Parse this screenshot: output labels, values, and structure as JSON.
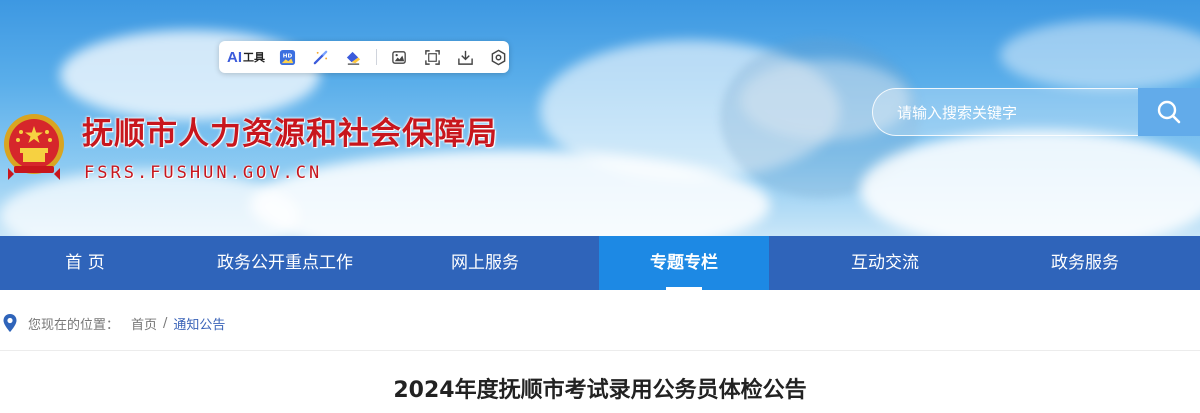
{
  "header": {
    "site_title": "抚顺市人力资源和社会保障局",
    "site_domain": "FSRS.FUSHUN.GOV.CN"
  },
  "toolbar": {
    "ai_label": "AI",
    "tool_label": "工具"
  },
  "search": {
    "placeholder": "请输入搜索关键字"
  },
  "nav": {
    "items": [
      {
        "label": "首  页"
      },
      {
        "label": "政务公开重点工作"
      },
      {
        "label": "网上服务"
      },
      {
        "label": "专题专栏"
      },
      {
        "label": "互动交流"
      },
      {
        "label": "政务服务"
      }
    ]
  },
  "breadcrumb": {
    "lead": "您现在的位置：",
    "home": "首页",
    "separator": "/",
    "current": "通知公告"
  },
  "article": {
    "title": "2024年度抚顺市考试录用公务员体检公告"
  },
  "colors": {
    "nav_bg": "#2f64ba",
    "nav_active": "#1d89e4",
    "title_red": "#c8161d"
  }
}
